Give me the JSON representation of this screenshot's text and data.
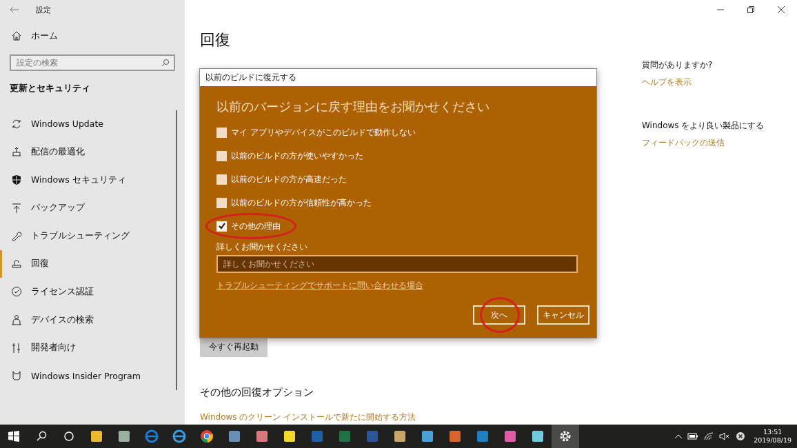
{
  "window": {
    "title": "設定"
  },
  "sidebar": {
    "home": "ホーム",
    "search": {
      "placeholder": "設定の検索"
    },
    "section": "更新とセキュリティ",
    "items": [
      {
        "label": "Windows Update",
        "kind": "update",
        "selected": false
      },
      {
        "label": "配信の最適化",
        "kind": "delivery",
        "selected": false
      },
      {
        "label": "Windows セキュリティ",
        "kind": "shield",
        "selected": false
      },
      {
        "label": "バックアップ",
        "kind": "backup",
        "selected": false
      },
      {
        "label": "トラブルシューティング",
        "kind": "wrench",
        "selected": false
      },
      {
        "label": "回復",
        "kind": "recovery",
        "selected": true
      },
      {
        "label": "ライセンス認証",
        "kind": "check",
        "selected": false
      },
      {
        "label": "デバイスの検索",
        "kind": "person",
        "selected": false
      },
      {
        "label": "開発者向け",
        "kind": "tools",
        "selected": false
      },
      {
        "label": "Windows Insider Program",
        "kind": "insider",
        "selected": false
      }
    ]
  },
  "main": {
    "title": "回復",
    "restart_button": "今すぐ再起動",
    "other_heading": "その他の回復オプション",
    "clean_install_link": "Windows のクリーン インストールで新たに開始する方法"
  },
  "aside": [
    {
      "heading": "質問がありますか?",
      "link": "ヘルプを表示"
    },
    {
      "heading": "Windows をより良い製品にする",
      "link": "フィードバックの送信"
    }
  ],
  "dialog": {
    "title": "以前のビルドに復元する",
    "heading": "以前のバージョンに戻す理由をお聞かせください",
    "reasons": [
      {
        "label": "マイ アプリやデバイスがこのビルドで動作しない",
        "checked": false,
        "circled": false
      },
      {
        "label": "以前のビルドの方が使いやすかった",
        "checked": false,
        "circled": false
      },
      {
        "label": "以前のビルドの方が高速だった",
        "checked": false,
        "circled": false
      },
      {
        "label": "以前のビルドの方が信頼性が高かった",
        "checked": false,
        "circled": false
      },
      {
        "label": "その他の理由",
        "checked": true,
        "circled": true
      }
    ],
    "details_label": "詳しくお聞かせください",
    "details_field": {
      "placeholder": "詳しくお聞かせください"
    },
    "support_link": "トラブルシューティングでサポートに問い合わせる場合",
    "buttons": [
      {
        "label": "次へ",
        "circled": true
      },
      {
        "label": "キャンセル",
        "circled": false
      }
    ]
  },
  "taskbar": {
    "apps": [
      {
        "kind": "folder",
        "selected": false
      },
      {
        "kind": "photos",
        "selected": false
      },
      {
        "kind": "edge",
        "selected": false
      },
      {
        "kind": "ie",
        "selected": false
      },
      {
        "kind": "chrome",
        "selected": false
      },
      {
        "kind": "globe",
        "selected": false
      },
      {
        "kind": "paint",
        "selected": false
      },
      {
        "kind": "sticky",
        "selected": false
      },
      {
        "kind": "blue",
        "selected": false
      },
      {
        "kind": "excel",
        "selected": false
      },
      {
        "kind": "word",
        "selected": false
      },
      {
        "kind": "palette",
        "selected": false
      },
      {
        "kind": "screen",
        "selected": false
      },
      {
        "kind": "toolbox",
        "selected": false
      },
      {
        "kind": "remote",
        "selected": false
      },
      {
        "kind": "colors",
        "selected": false
      },
      {
        "kind": "slack",
        "selected": false
      },
      {
        "kind": "settings",
        "selected": true
      }
    ],
    "time": "13:51",
    "date": "2019/08/19"
  }
}
